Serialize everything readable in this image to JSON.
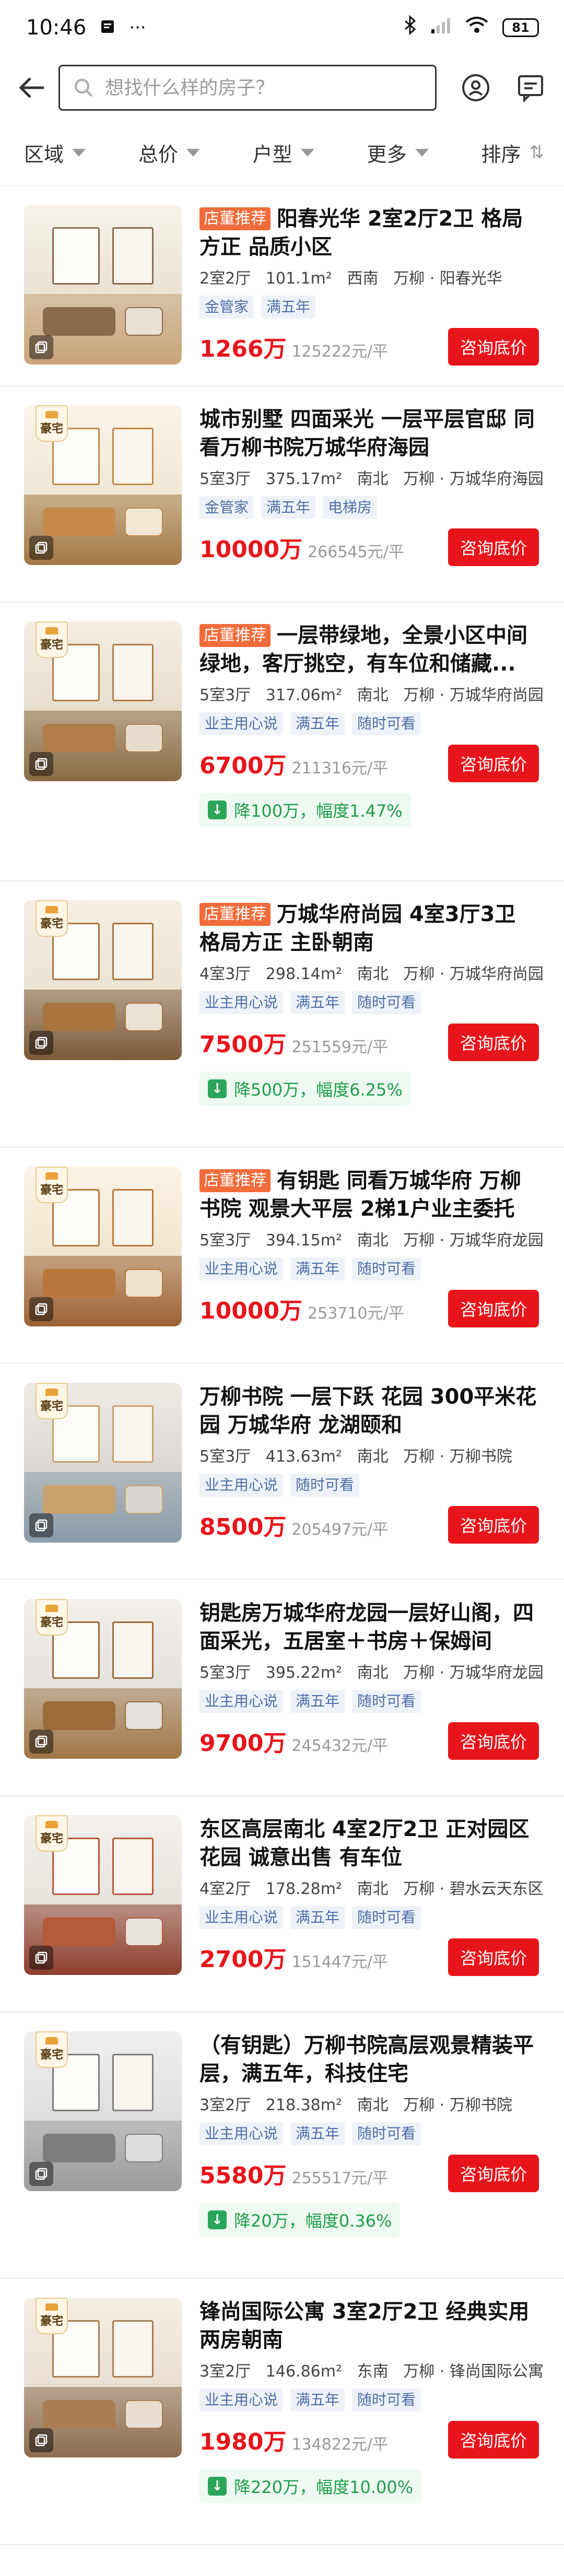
{
  "status": {
    "time": "10:46",
    "battery": "81"
  },
  "search": {
    "placeholder": "想找什么样的房子？"
  },
  "filters": [
    {
      "label": "区域"
    },
    {
      "label": "总价"
    },
    {
      "label": "户型"
    },
    {
      "label": "更多"
    },
    {
      "label": "排序"
    }
  ],
  "cta_label": "咨询底价",
  "listings": [
    {
      "store_badge": "店董推荐",
      "title": "阳春光华 2室2厅2卫 格局方正 品质小区",
      "layout": "2室2厅",
      "area": "101.1m²",
      "orientation": "西南",
      "location": "万柳 · 阳春光华",
      "tags": [
        "金管家",
        "满五年"
      ],
      "price": "1266万",
      "unit_price": "125222元/平",
      "haozhai": false,
      "price_drop": ""
    },
    {
      "store_badge": "",
      "title": "城市别墅 四面采光 一层平层官邸 同看万柳书院万城华府海园",
      "layout": "5室3厅",
      "area": "375.17m²",
      "orientation": "南北",
      "location": "万柳 · 万城华府海园",
      "tags": [
        "金管家",
        "满五年",
        "电梯房"
      ],
      "price": "10000万",
      "unit_price": "266545元/平",
      "haozhai": true,
      "price_drop": ""
    },
    {
      "store_badge": "店董推荐",
      "title": "一层带绿地，全景小区中间绿地，客厅挑空，有车位和储藏...",
      "layout": "5室3厅",
      "area": "317.06m²",
      "orientation": "南北",
      "location": "万柳 · 万城华府尚园",
      "tags": [
        "业主用心说",
        "满五年",
        "随时可看"
      ],
      "price": "6700万",
      "unit_price": "211316元/平",
      "haozhai": true,
      "price_drop": "降100万，幅度1.47%"
    },
    {
      "store_badge": "店董推荐",
      "title": "万城华府尚园 4室3厅3卫 格局方正 主卧朝南",
      "layout": "4室3厅",
      "area": "298.14m²",
      "orientation": "南北",
      "location": "万柳 · 万城华府尚园",
      "tags": [
        "业主用心说",
        "满五年",
        "随时可看"
      ],
      "price": "7500万",
      "unit_price": "251559元/平",
      "haozhai": true,
      "price_drop": "降500万，幅度6.25%"
    },
    {
      "store_badge": "店董推荐",
      "title": "有钥匙 同看万城华府 万柳书院 观景大平层 2梯1户业主委托",
      "layout": "5室3厅",
      "area": "394.15m²",
      "orientation": "南北",
      "location": "万柳 · 万城华府龙园",
      "tags": [
        "业主用心说",
        "满五年",
        "随时可看"
      ],
      "price": "10000万",
      "unit_price": "253710元/平",
      "haozhai": true,
      "price_drop": ""
    },
    {
      "store_badge": "",
      "title": "万柳书院 一层下跃 花园 300平米花园 万城华府 龙湖颐和",
      "layout": "5室3厅",
      "area": "413.63m²",
      "orientation": "南北",
      "location": "万柳 · 万柳书院",
      "tags": [
        "业主用心说",
        "随时可看"
      ],
      "price": "8500万",
      "unit_price": "205497元/平",
      "haozhai": true,
      "price_drop": ""
    },
    {
      "store_badge": "",
      "title": "钥匙房万城华府龙园一层好山阁，四面采光，五居室＋书房＋保姆间",
      "layout": "5室3厅",
      "area": "395.22m²",
      "orientation": "南北",
      "location": "万柳 · 万城华府龙园",
      "tags": [
        "业主用心说",
        "满五年",
        "随时可看"
      ],
      "price": "9700万",
      "unit_price": "245432元/平",
      "haozhai": true,
      "price_drop": ""
    },
    {
      "store_badge": "",
      "title": "东区高层南北 4室2厅2卫 正对园区花园 诚意出售 有车位",
      "layout": "4室2厅",
      "area": "178.28m²",
      "orientation": "南北",
      "location": "万柳 · 碧水云天东区",
      "tags": [
        "业主用心说",
        "满五年",
        "随时可看"
      ],
      "price": "2700万",
      "unit_price": "151447元/平",
      "haozhai": true,
      "price_drop": ""
    },
    {
      "store_badge": "",
      "title": "（有钥匙）万柳书院高层观景精装平层，满五年，科技住宅",
      "layout": "3室2厅",
      "area": "218.38m²",
      "orientation": "南北",
      "location": "万柳 · 万柳书院",
      "tags": [
        "业主用心说",
        "满五年",
        "随时可看"
      ],
      "price": "5580万",
      "unit_price": "255517元/平",
      "haozhai": true,
      "price_drop": "降20万，幅度0.36%"
    },
    {
      "store_badge": "",
      "title": "锋尚国际公寓 3室2厅2卫 经典实用 两房朝南",
      "layout": "3室2厅",
      "area": "146.86m²",
      "orientation": "东南",
      "location": "万柳 · 锋尚国际公寓",
      "tags": [
        "业主用心说",
        "满五年",
        "随时可看"
      ],
      "price": "1980万",
      "unit_price": "134822元/平",
      "haozhai": true,
      "price_drop": "降220万，幅度10.00%"
    }
  ],
  "colors": {
    "accent_red": "#e8141b",
    "store_badge": "#f26b3a",
    "drop_green": "#1f9d4c",
    "tag_blue": "#4f6fa8"
  },
  "icons": [
    "back-arrow-icon",
    "search-icon",
    "user-location-icon",
    "message-icon",
    "photo-gallery-icon",
    "haozhai-badge-icon",
    "down-arrow-icon"
  ]
}
